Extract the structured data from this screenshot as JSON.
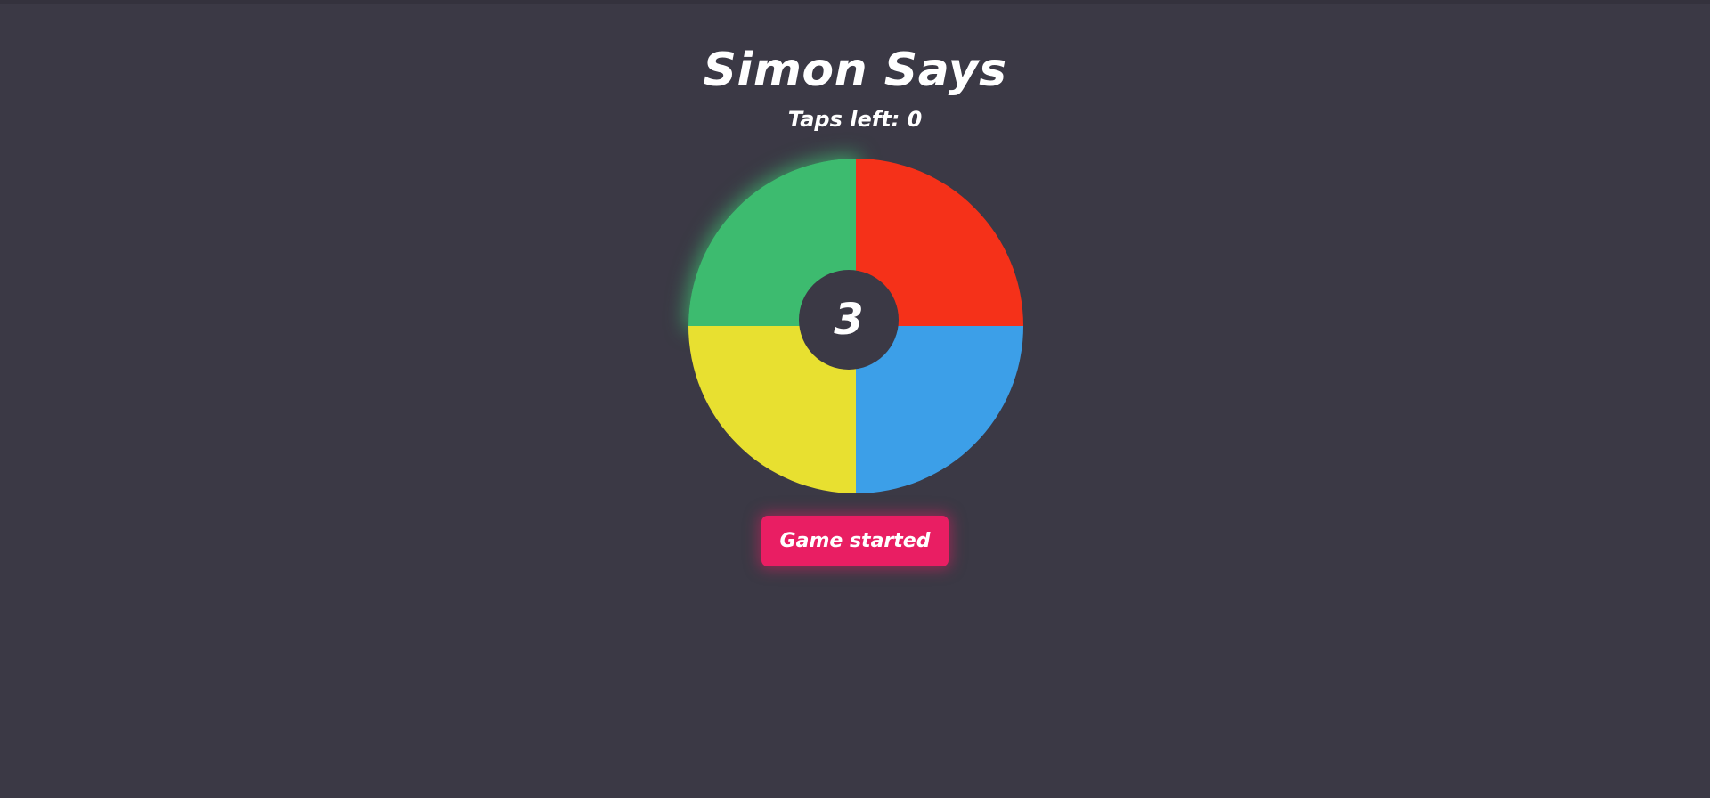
{
  "game": {
    "title": "Simon Says",
    "taps_label": "Taps left: 0",
    "round_number": "3",
    "status_button_label": "Game started"
  },
  "pads": [
    {
      "color_name": "green",
      "color": "#3dbb6f",
      "lit": true
    },
    {
      "color_name": "red",
      "color": "#f53119",
      "lit": false
    },
    {
      "color_name": "yellow",
      "color": "#e8e030",
      "lit": false
    },
    {
      "color_name": "blue",
      "color": "#3c9fe8",
      "lit": false
    }
  ],
  "colors": {
    "background": "#3b3945",
    "button": "#e91e63",
    "text": "#ffffff"
  }
}
